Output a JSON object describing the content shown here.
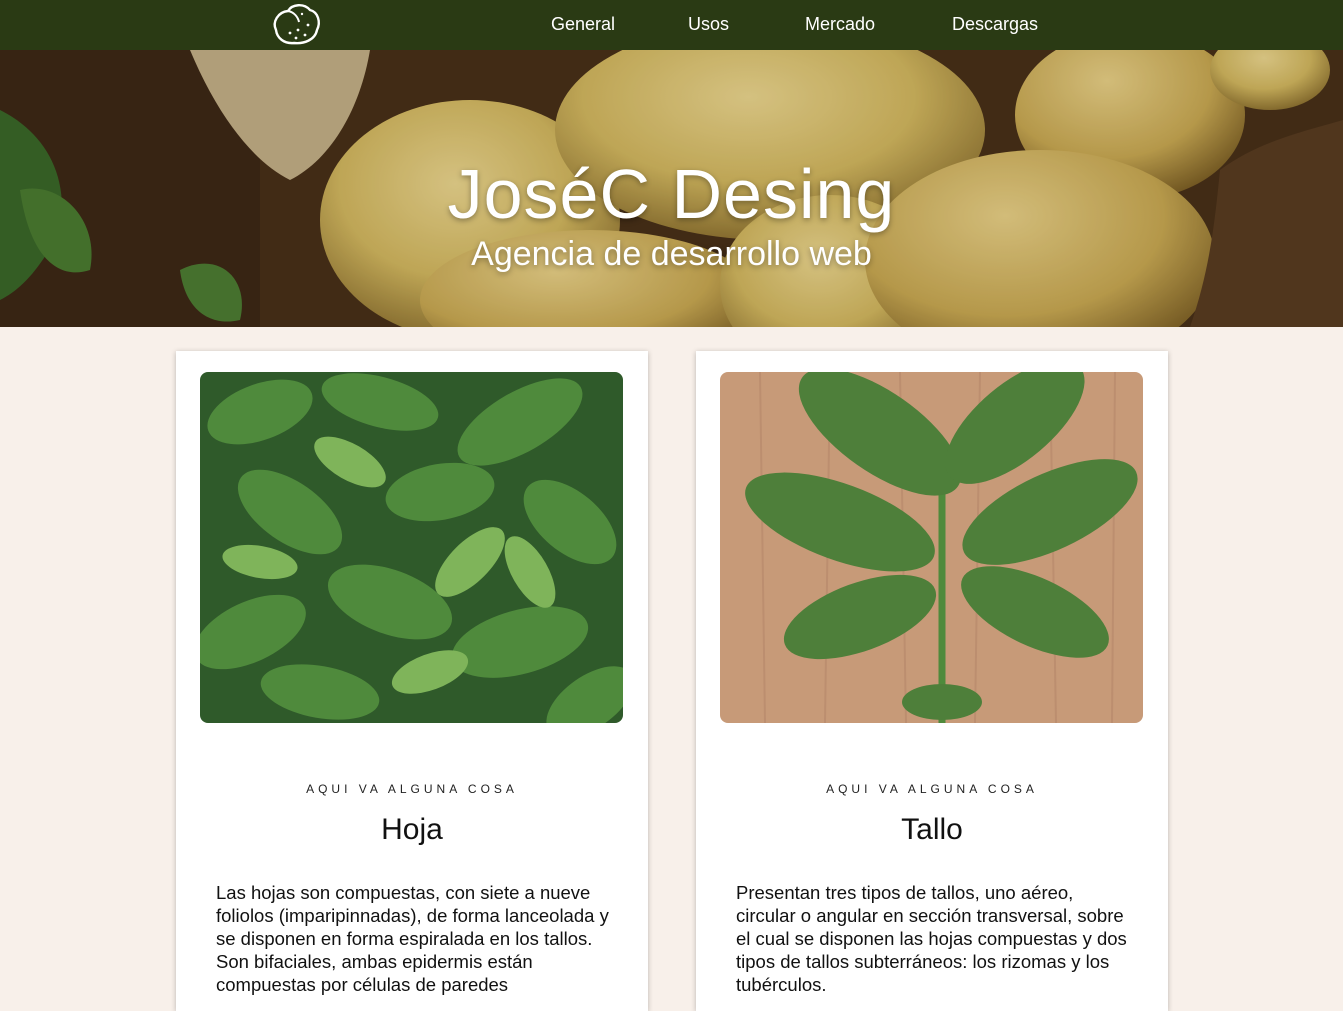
{
  "nav": {
    "logo_icon": "potato-icon",
    "links": [
      "General",
      "Usos",
      "Mercado",
      "Descargas"
    ]
  },
  "hero": {
    "title": "JoséC Desing",
    "subtitle": "Agencia de desarrollo web"
  },
  "cards": [
    {
      "kicker": "AQUI VA ALGUNA COSA",
      "title": "Hoja",
      "text": "Las hojas son compuestas, con siete a nueve foliolos (imparipinnadas), de forma lanceolada y se disponen en forma espiralada en los tallos. Son bifaciales, ambas epidermis están compuestas por células de paredes"
    },
    {
      "kicker": "AQUI VA ALGUNA COSA",
      "title": "Tallo",
      "text": "Presentan tres tipos de tallos, uno aéreo, circular o angular en sección transversal, sobre el cual se disponen las hojas compuestas y dos tipos de tallos subterráneos: los rizomas y los tubérculos."
    }
  ],
  "colors": {
    "nav_bg": "#2a3a14",
    "page_bg": "#f8f0ea"
  }
}
